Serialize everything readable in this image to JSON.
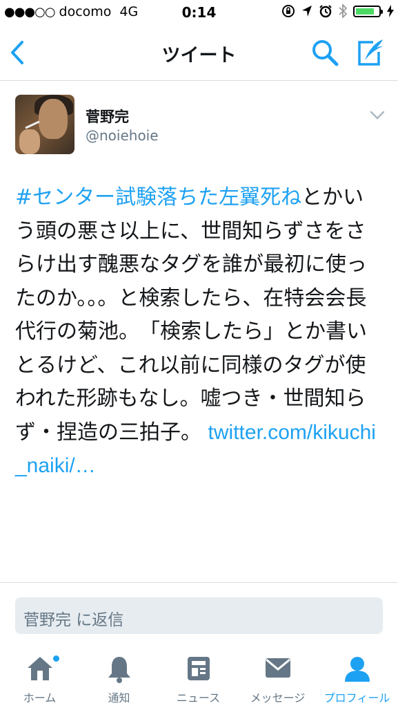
{
  "status_bar": {
    "signal": "●●●○○",
    "carrier": "docomo",
    "network": "4G",
    "time": "0:14",
    "battery_level": 0.8,
    "icons": [
      "rotation-lock-icon",
      "location-icon",
      "alarm-icon",
      "bluetooth-icon",
      "battery-icon",
      "charging-icon"
    ]
  },
  "nav": {
    "title": "ツイート",
    "icons": [
      "back-chevron-icon",
      "search-icon",
      "compose-icon"
    ]
  },
  "tweet": {
    "author_name": "菅野完",
    "author_handle": "@noiehoie",
    "hashtag": "#センター試験落ちた左翼死ね",
    "body": "とかいう頭の悪さ以上に、世間知らずさをさらけ出す醜悪なタグを誰が最初に使ったのか。。。と検索したら、在特会会長代行の菊池。　「検索したら」とか書いとるけど、これ以前に同様のタグが使われた形跡もなし。嘘つき・世間知らず・捏造の三拍子。",
    "link": "twitter.com/kikuchi_naiki/…"
  },
  "reply": {
    "placeholder": "菅野完 に返信"
  },
  "tabs": [
    {
      "label": "ホーム",
      "icon": "home-icon",
      "active": false,
      "badge": true
    },
    {
      "label": "通知",
      "icon": "bell-icon",
      "active": false,
      "badge": false
    },
    {
      "label": "ニュース",
      "icon": "news-icon",
      "active": false,
      "badge": false
    },
    {
      "label": "メッセージ",
      "icon": "envelope-icon",
      "active": false,
      "badge": false
    },
    {
      "label": "プロフィール",
      "icon": "person-icon",
      "active": true,
      "badge": false
    }
  ],
  "colors": {
    "accent": "#1da1f2",
    "text": "#14171a",
    "secondary": "#657786",
    "inactive_icon": "#657786",
    "reply_bg": "#e6ecf0"
  }
}
